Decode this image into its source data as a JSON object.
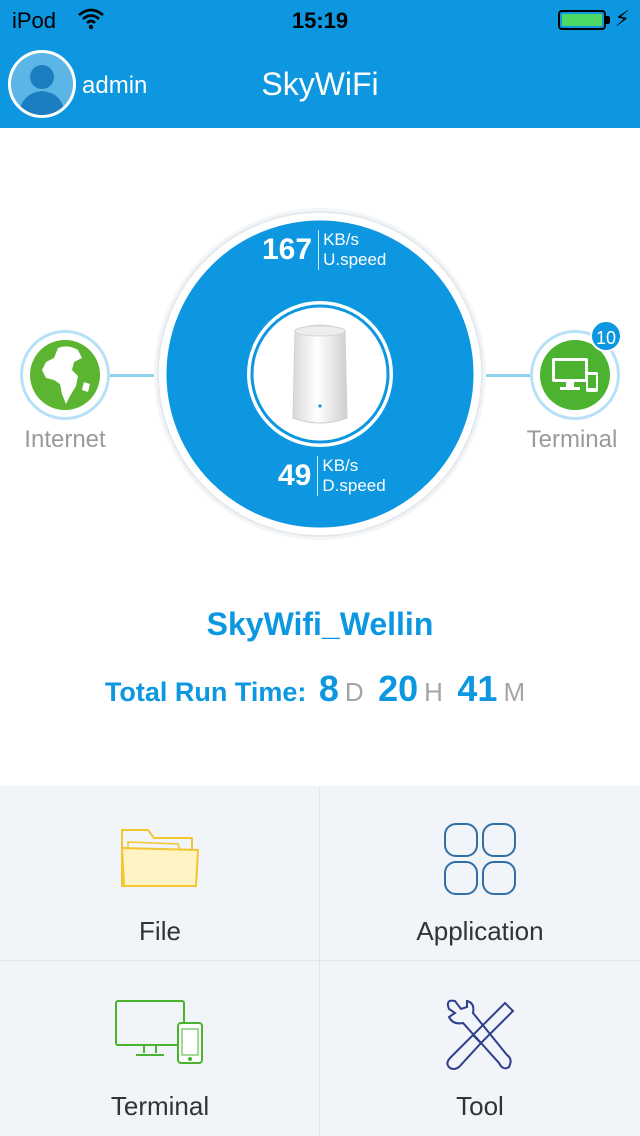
{
  "status_bar": {
    "carrier": "iPod",
    "time": "15:19",
    "battery_level": 1.0,
    "icons": [
      "wifi-icon",
      "battery-icon",
      "charging-icon"
    ]
  },
  "header": {
    "username": "admin",
    "title": "SkyWiFi"
  },
  "network": {
    "internet_label": "Internet",
    "terminal_label": "Terminal",
    "terminal_count": "10",
    "upload": {
      "value": "167",
      "unit": "KB/s",
      "label": "U.speed"
    },
    "download": {
      "value": "49",
      "unit": "KB/s",
      "label": "D.speed"
    }
  },
  "device": {
    "ssid": "SkyWifi_Wellin",
    "runtime_label": "Total Run Time:",
    "days": "8",
    "days_unit": "D",
    "hours": "20",
    "hours_unit": "H",
    "minutes": "41",
    "minutes_unit": "M"
  },
  "menu": {
    "file": "File",
    "application": "Application",
    "terminal": "Terminal",
    "tool": "Tool"
  },
  "colors": {
    "primary": "#0c97e0",
    "internet_green": "#5cb531",
    "terminal_green": "#4bb330",
    "file_yellow": "#f3c52e",
    "app_blue": "#2e6fa8",
    "tool_navy": "#2f3f8c"
  }
}
